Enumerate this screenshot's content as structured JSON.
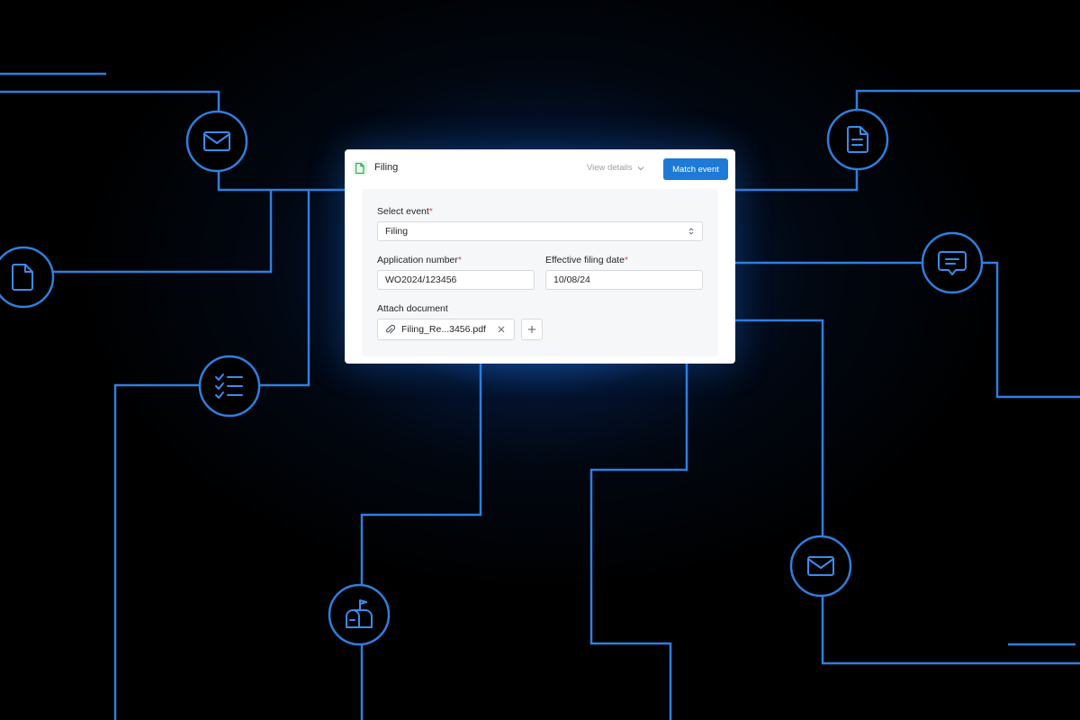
{
  "theme": {
    "background": "#000000",
    "line_color": "#2f7fe0",
    "glow_color": "#1e7ad6",
    "accent_button": "#1e7ad6",
    "required_marker": "#e5484d"
  },
  "card": {
    "title": "Filing",
    "title_icon": "document-icon",
    "view_details_label": "View details",
    "match_button_label": "Match event"
  },
  "form": {
    "select_event": {
      "label": "Select event",
      "required_mark": "*",
      "value": "Filing"
    },
    "application_number": {
      "label": "Application number",
      "required_mark": "*",
      "value": "WO2024/123456"
    },
    "effective_filing_date": {
      "label": "Effective filing date",
      "required_mark": "*",
      "value": "10/08/24"
    },
    "attach_document": {
      "label": "Attach document",
      "file_name": "Filing_Re...3456.pdf"
    }
  },
  "background_nodes": [
    {
      "icon": "envelope-icon"
    },
    {
      "icon": "document-icon"
    },
    {
      "icon": "checklist-icon"
    },
    {
      "icon": "mailbox-icon"
    },
    {
      "icon": "document-lines-icon"
    },
    {
      "icon": "chat-bubble-icon"
    },
    {
      "icon": "envelope-icon"
    }
  ]
}
